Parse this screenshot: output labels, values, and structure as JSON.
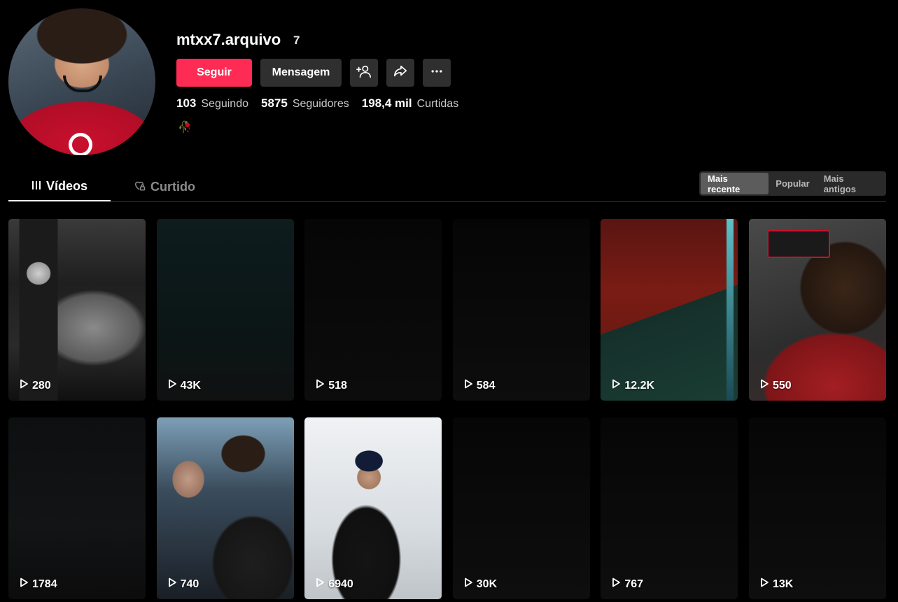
{
  "profile": {
    "username": "mtxx7.arquivo",
    "badge_number": "7",
    "bio_emoji": "🥀"
  },
  "actions": {
    "follow_label": "Seguir",
    "message_label": "Mensagem",
    "add_friend_icon": "add-user-icon",
    "share_icon": "share-arrow-icon",
    "more_icon": "more-dots-icon"
  },
  "stats": {
    "following_count": "103",
    "following_label": "Seguindo",
    "followers_count": "5875",
    "followers_label": "Seguidores",
    "likes_count": "198,4 mil",
    "likes_label": "Curtidas"
  },
  "tabs": {
    "videos": "Vídeos",
    "liked": "Curtido",
    "active": "Vídeos"
  },
  "sort": {
    "options": [
      "Mais recente",
      "Popular",
      "Mais antigos"
    ],
    "selected": "Mais recente"
  },
  "videos": [
    {
      "views": "280"
    },
    {
      "views": "43K"
    },
    {
      "views": "518"
    },
    {
      "views": "584"
    },
    {
      "views": "12.2K"
    },
    {
      "views": "550"
    },
    {
      "views": "1784"
    },
    {
      "views": "740"
    },
    {
      "views": "6940"
    },
    {
      "views": "30K"
    },
    {
      "views": "767"
    },
    {
      "views": "13K"
    }
  ],
  "colors": {
    "accent": "#fe2c55",
    "background": "#000000",
    "button_secondary": "#2f2f2f"
  }
}
